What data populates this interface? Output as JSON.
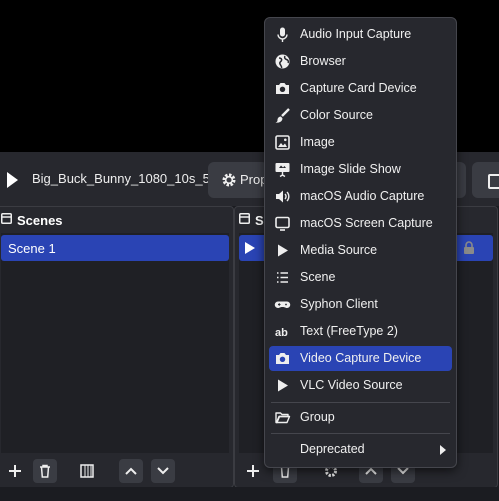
{
  "media": {
    "name": "Big_Buck_Bunny_1080_10s_5",
    "properties_label": "Prop"
  },
  "scenes": {
    "title": "Scenes",
    "items": [
      "Scene 1"
    ]
  },
  "sources": {
    "title": "S"
  },
  "menu": {
    "items": [
      {
        "label": "Audio Input Capture",
        "icon": "microphone-icon"
      },
      {
        "label": "Browser",
        "icon": "globe-icon"
      },
      {
        "label": "Capture Card Device",
        "icon": "camera-icon"
      },
      {
        "label": "Color Source",
        "icon": "paintbrush-icon"
      },
      {
        "label": "Image",
        "icon": "image-icon"
      },
      {
        "label": "Image Slide Show",
        "icon": "slideshow-icon"
      },
      {
        "label": "macOS Audio Capture",
        "icon": "speaker-icon"
      },
      {
        "label": "macOS Screen Capture",
        "icon": "monitor-icon"
      },
      {
        "label": "Media Source",
        "icon": "play-icon"
      },
      {
        "label": "Scene",
        "icon": "list-icon"
      },
      {
        "label": "Syphon Client",
        "icon": "gamepad-icon"
      },
      {
        "label": "Text (FreeType 2)",
        "icon": "text-icon"
      },
      {
        "label": "Video Capture Device",
        "icon": "camera-icon"
      },
      {
        "label": "VLC Video Source",
        "icon": "play-icon"
      }
    ],
    "group_label": "Group",
    "deprecated_label": "Deprecated",
    "selected": "Video Capture Device"
  },
  "colors": {
    "accent": "#2a44b4",
    "panel": "#27282e",
    "background": "#1b1c21"
  }
}
